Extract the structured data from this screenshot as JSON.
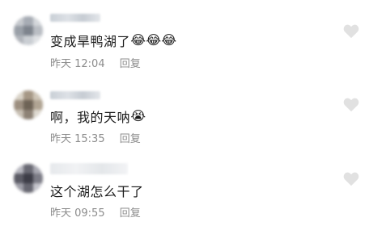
{
  "comments": [
    {
      "text": "变成旱鸭湖了",
      "emojis": [
        "😂",
        "😂",
        "😂"
      ],
      "time": "昨天 12:04",
      "reply_label": "回复",
      "like_icon": "heart-outline-icon"
    },
    {
      "text": "啊，我的天呐",
      "emojis": [
        "😭"
      ],
      "time": "昨天 15:35",
      "reply_label": "回复",
      "like_icon": "heart-outline-icon"
    },
    {
      "text": "这个湖怎么干了",
      "emojis": [],
      "time": "昨天 09:55",
      "reply_label": "回复",
      "like_icon": "heart-outline-icon"
    }
  ],
  "colors": {
    "text": "#1a1a1a",
    "meta": "#8c8c8c",
    "heart": "#e1e1e1"
  }
}
